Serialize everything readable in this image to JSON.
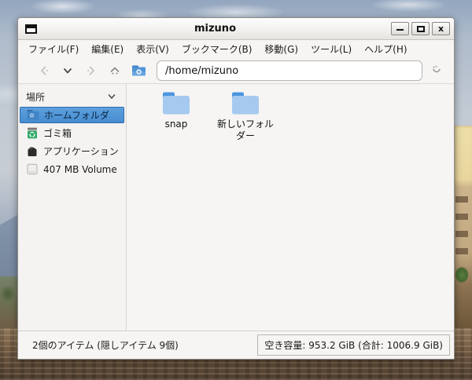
{
  "window": {
    "title": "mizuno"
  },
  "titlebar": {
    "icons": {
      "window_menu": "window-glyph",
      "minimize": "minimize-glyph",
      "maximize": "maximize-glyph",
      "close": "close-glyph"
    },
    "close_glyph": "x"
  },
  "menubar": {
    "items": [
      "ファイル(F)",
      "編集(E)",
      "表示(V)",
      "ブックマーク(B)",
      "移動(G)",
      "ツール(L)",
      "ヘルプ(H)"
    ]
  },
  "toolbar": {
    "path": "/home/mizuno",
    "icons": {
      "back": "chevron-double-left",
      "history": "chevron-down",
      "forward": "chevron-double-right",
      "up": "chevron-up",
      "home": "home-folder",
      "go": "jump-to"
    }
  },
  "sidebar": {
    "header": "場所",
    "items": [
      {
        "label": "ホームフォルダ",
        "icon": "home-folder-icon",
        "selected": true
      },
      {
        "label": "ゴミ箱",
        "icon": "trash-icon",
        "selected": false
      },
      {
        "label": "アプリケーション",
        "icon": "applications-icon",
        "selected": false
      },
      {
        "label": "407 MB Volume",
        "icon": "volume-icon",
        "selected": false
      }
    ]
  },
  "files": {
    "items": [
      {
        "name": "snap",
        "icon": "folder-icon"
      },
      {
        "name": "新しいフォルダー",
        "icon": "folder-icon"
      }
    ]
  },
  "statusbar": {
    "left": "2個のアイテム (隠しアイテム 9個)",
    "right": "空き容量: 953.2 GiB (合計: 1006.9 GiB)"
  },
  "colors": {
    "selection_blue": "#478cd0",
    "folder_tab": "#4d96e0",
    "folder_body": "#a6c9f0",
    "trash_green": "#33ab6b",
    "titlebar_gradient_top": "#fdfdfd",
    "titlebar_gradient_bottom": "#e6e4e1"
  }
}
